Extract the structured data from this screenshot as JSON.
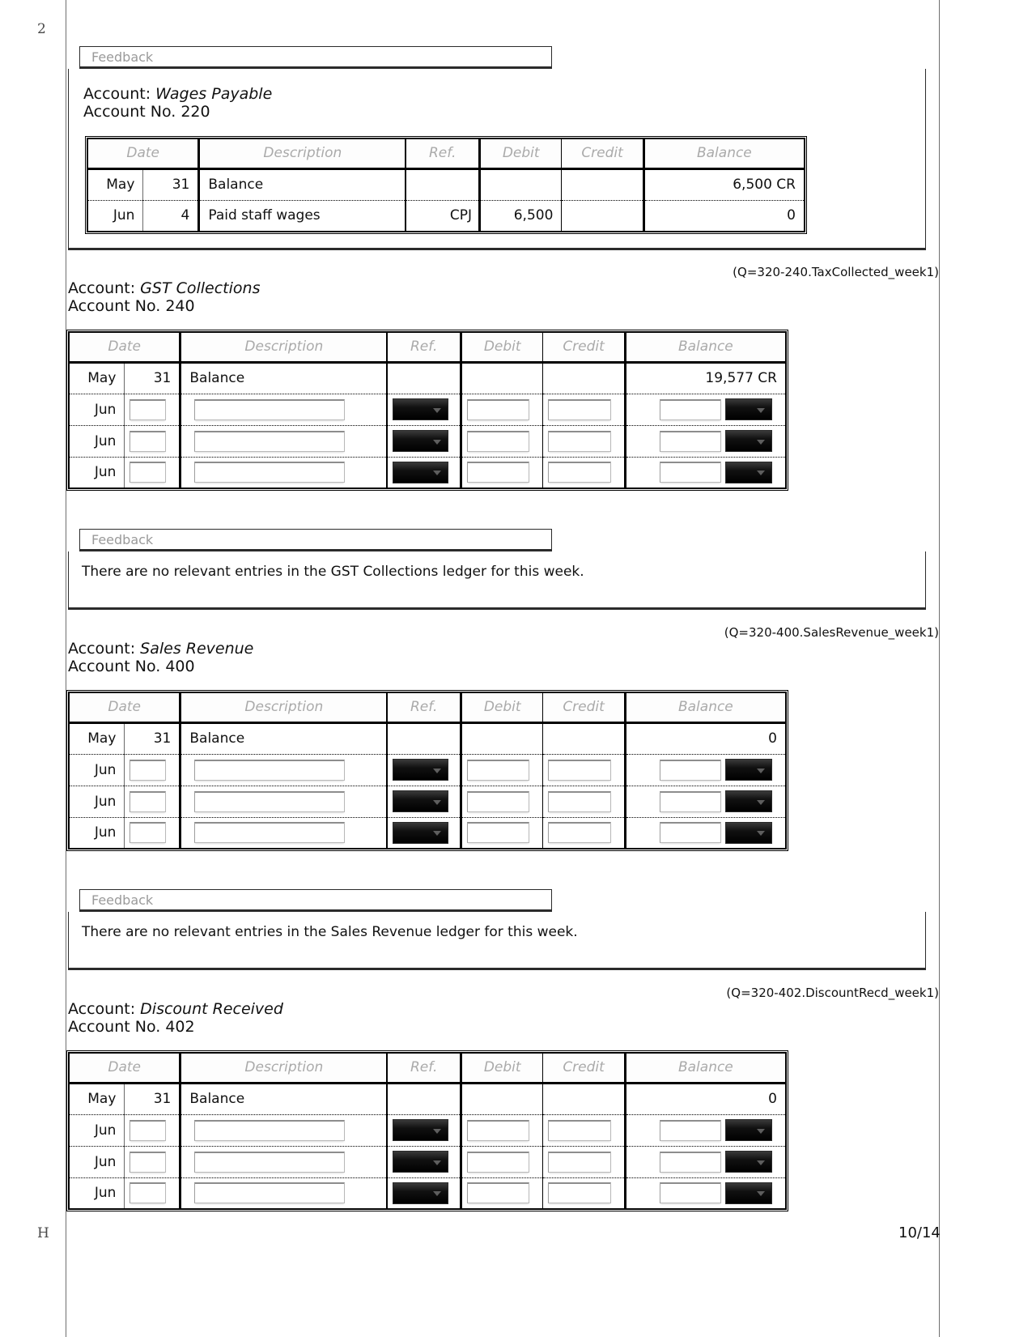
{
  "page": {
    "crop_mark_top": "2",
    "crop_mark_bottom": "H",
    "page_number": "10/14"
  },
  "feedback_label": "Feedback",
  "table_headers": {
    "date": "Date",
    "description": "Description",
    "ref": "Ref.",
    "debit": "Debit",
    "credit": "Credit",
    "balance": "Balance"
  },
  "sections": [
    {
      "id": "wages-payable",
      "account_prefix": "Account: ",
      "account_name": "Wages Payable",
      "account_no_line": "Account No. 220",
      "rows": [
        {
          "type": "static",
          "month": "May",
          "day": "31",
          "description": "Balance",
          "ref": "",
          "debit": "",
          "credit": "",
          "balance": "6,500 CR"
        },
        {
          "type": "static",
          "month": "Jun",
          "day": "4",
          "description": "Paid staff wages",
          "ref": "CPJ",
          "debit": "6,500",
          "credit": "",
          "balance": "0"
        }
      ]
    },
    {
      "id": "gst-collections",
      "question_id": "(Q=320-240.TaxCollected_week1)",
      "account_prefix": "Account: ",
      "account_name": "GST Collections",
      "account_no_line": "Account No. 240",
      "rows": [
        {
          "type": "static",
          "month": "May",
          "day": "31",
          "description": "Balance",
          "ref": "",
          "debit": "",
          "credit": "",
          "balance": "19,577 CR"
        },
        {
          "type": "input",
          "month": "Jun"
        },
        {
          "type": "input",
          "month": "Jun"
        },
        {
          "type": "input",
          "month": "Jun"
        }
      ],
      "feedback": "There are no relevant entries in the GST Collections ledger for this week."
    },
    {
      "id": "sales-revenue",
      "question_id": "(Q=320-400.SalesRevenue_week1)",
      "account_prefix": "Account: ",
      "account_name": "Sales Revenue",
      "account_no_line": "Account No. 400",
      "rows": [
        {
          "type": "static",
          "month": "May",
          "day": "31",
          "description": "Balance",
          "ref": "",
          "debit": "",
          "credit": "",
          "balance": "0"
        },
        {
          "type": "input",
          "month": "Jun"
        },
        {
          "type": "input",
          "month": "Jun"
        },
        {
          "type": "input",
          "month": "Jun"
        }
      ],
      "feedback": "There are no relevant entries in the Sales Revenue ledger for this week."
    },
    {
      "id": "discount-received",
      "question_id": "(Q=320-402.DiscountRecd_week1)",
      "account_prefix": "Account: ",
      "account_name": "Discount Received",
      "account_no_line": "Account No. 402",
      "rows": [
        {
          "type": "static",
          "month": "May",
          "day": "31",
          "description": "Balance",
          "ref": "",
          "debit": "",
          "credit": "",
          "balance": "0"
        },
        {
          "type": "input",
          "month": "Jun"
        },
        {
          "type": "input",
          "month": "Jun"
        },
        {
          "type": "input",
          "month": "Jun"
        }
      ]
    }
  ]
}
